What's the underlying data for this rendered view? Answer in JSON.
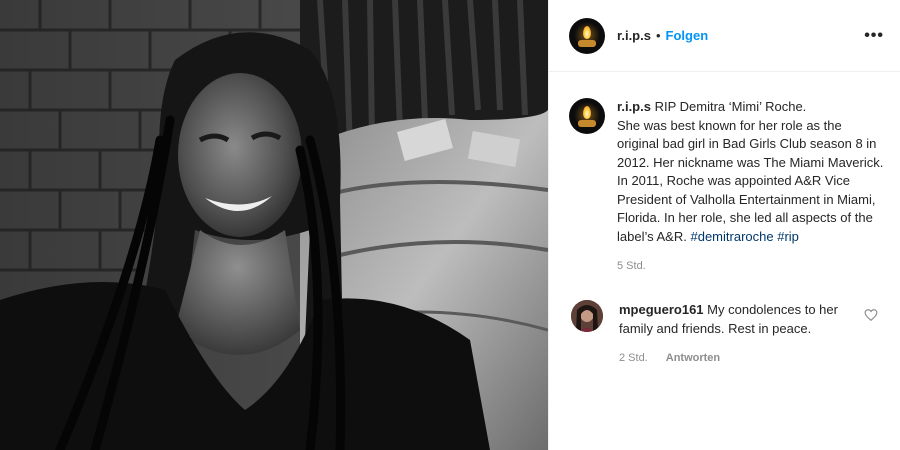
{
  "post": {
    "photo_icon": "post-photo",
    "header": {
      "username": "r.i.p.s",
      "separator": "•",
      "follow_label": "Folgen",
      "more_icon": "more-options-icon",
      "more_label": "•••"
    },
    "caption": {
      "username": "r.i.p.s",
      "lines": [
        "RIP Demitra ‘Mimi’ Roche.",
        "She was best known for her role as the original bad girl in Bad Girls Club season 8 in 2012. Her nickname was The Miami Maverick.",
        "In 2011, Roche was appointed A&R Vice President of Valholla Entertainment in Miami, Florida. In her role, she led all aspects of the label’s A&R."
      ],
      "hashtags": [
        "#demitraroche",
        "#rip"
      ],
      "time": "5 Std."
    },
    "comment": {
      "username": "mpeguero161",
      "text": "My condolences to her family and friends. Rest in peace.",
      "time": "2 Std.",
      "reply_label": "Antworten",
      "like_icon": "heart-icon"
    }
  },
  "colors": {
    "link": "#0095f6",
    "hashtag": "#00376b",
    "muted": "#8e8e8e",
    "text": "#262626"
  }
}
